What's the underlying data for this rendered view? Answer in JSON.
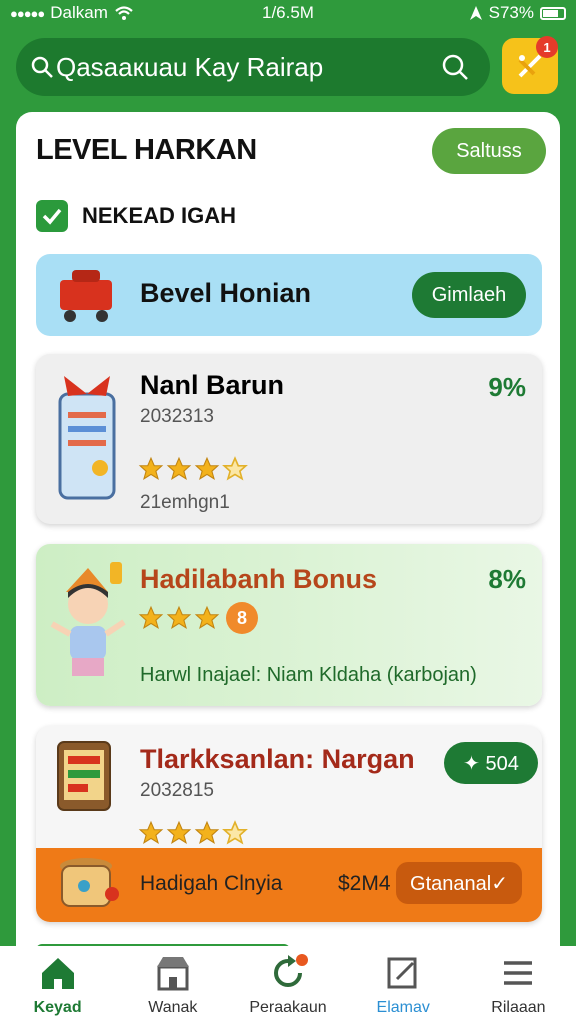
{
  "status_bar": {
    "carrier": "Dalkam",
    "time": "1/6.5M",
    "battery": "S73%"
  },
  "search": {
    "text": "Qasaaкuau Kay Rairap"
  },
  "notification": {
    "count": "1"
  },
  "card": {
    "header": "LEVEL HARKAN",
    "status_button": "Saltuss",
    "check_label": "NEKEAD IGAH"
  },
  "level_card": {
    "title": "Bevel Honian",
    "button": "Gimlaeh"
  },
  "items": [
    {
      "title": "Nanl Barun",
      "percent": "9%",
      "code": "2032313",
      "stars": 3,
      "footer": "21emhgn1",
      "title_color": "#111111"
    },
    {
      "title": "Hadilabanh Bonus",
      "percent": "8%",
      "stars": 3,
      "badge": "8",
      "footer": "Harwl Inajael: Niam Kldaha (karbojan)",
      "title_color": "#b6461b"
    },
    {
      "title": "Tlarkksanlan: Nargan",
      "code": "2032815",
      "tag": "✦ 504",
      "stars": 3,
      "strip_label": "Hadigah Clnyia",
      "strip_price": "$2M4",
      "strip_button": "Gtananal✓",
      "title_color": "#a42a1a"
    }
  ],
  "bottom_nav": [
    {
      "label": "Keyad",
      "icon": "home-icon",
      "active": true
    },
    {
      "label": "Wanak",
      "icon": "store-icon"
    },
    {
      "label": "Peraakaun",
      "icon": "refresh-icon",
      "dot": true
    },
    {
      "label": "Elamav",
      "icon": "edit-icon",
      "blue": true
    },
    {
      "label": "Rilaaan",
      "icon": "menu-icon"
    }
  ],
  "colors": {
    "primary_green": "#2f9a3c",
    "dark_green": "#1e7a34",
    "accent_yellow": "#f6c21a",
    "level_blue": "#a9dff5",
    "orange": "#ef7a17"
  }
}
